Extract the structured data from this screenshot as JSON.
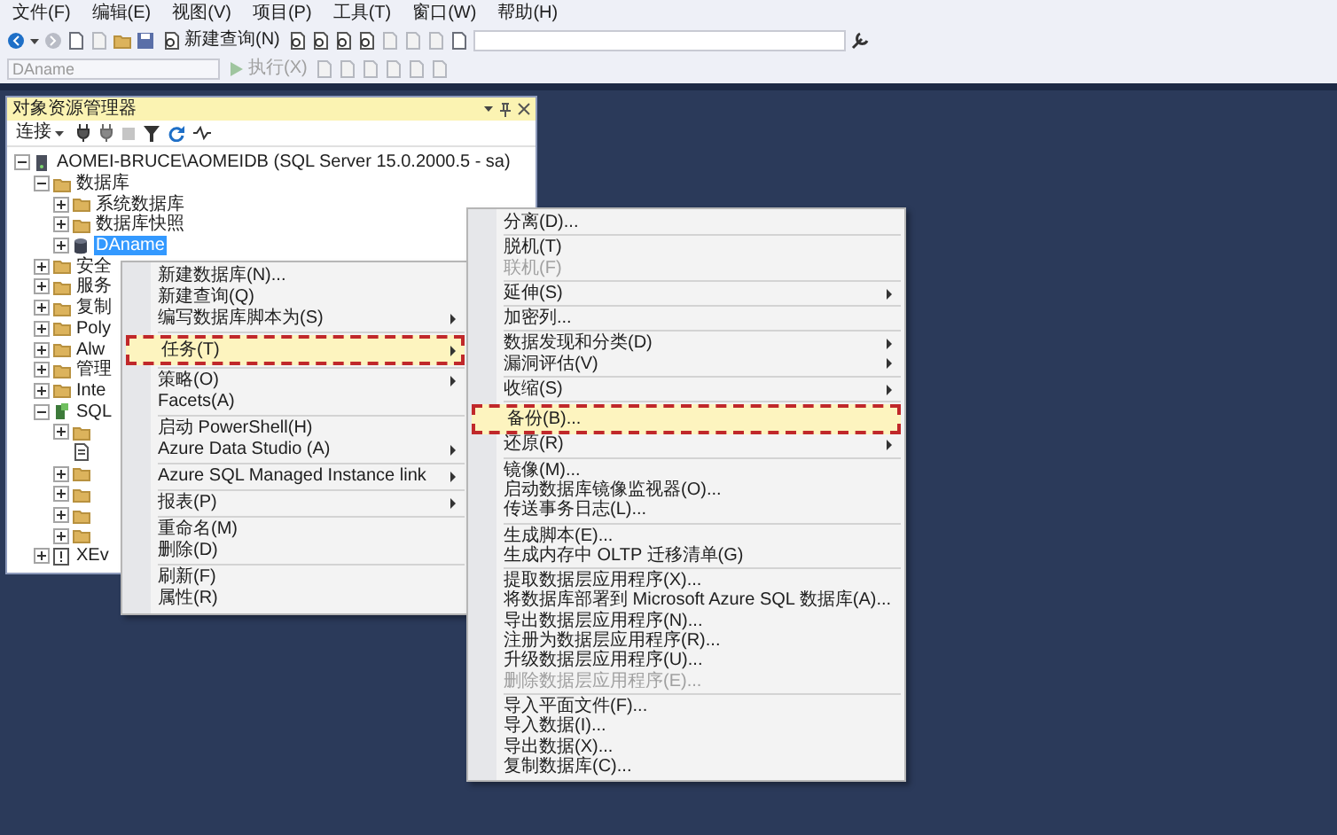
{
  "menubar": [
    "文件(F)",
    "编辑(E)",
    "视图(V)",
    "项目(P)",
    "工具(T)",
    "窗口(W)",
    "帮助(H)"
  ],
  "toolbar": {
    "new_query": "新建查询(N)",
    "database_select": "DAname",
    "execute": "执行(X)"
  },
  "object_explorer": {
    "title": "对象资源管理器",
    "connect": "连接",
    "tree": [
      {
        "label": "AOMEI-BRUCE\\AOMEIDB (SQL Server 15.0.2000.5 - sa)",
        "kind": "server",
        "expanded": true,
        "selected": false,
        "children": [
          {
            "label": "数据库",
            "kind": "folder",
            "expanded": true,
            "selected": false,
            "children": [
              {
                "label": "系统数据库",
                "kind": "folder",
                "expanded": false,
                "selected": false
              },
              {
                "label": "数据库快照",
                "kind": "folder",
                "expanded": false,
                "selected": false
              },
              {
                "label": "DAname",
                "kind": "database",
                "expanded": false,
                "selected": true
              }
            ]
          },
          {
            "label": "安全",
            "kind": "folder",
            "expanded": false,
            "selected": false
          },
          {
            "label": "服务",
            "kind": "folder",
            "expanded": false,
            "selected": false
          },
          {
            "label": "复制",
            "kind": "folder",
            "expanded": false,
            "selected": false
          },
          {
            "label": "Poly",
            "kind": "folder",
            "expanded": false,
            "selected": false
          },
          {
            "label": "Alw",
            "kind": "folder",
            "expanded": false,
            "selected": false
          },
          {
            "label": "管理",
            "kind": "folder",
            "expanded": false,
            "selected": false
          },
          {
            "label": "Inte",
            "kind": "folder",
            "expanded": false,
            "selected": false
          },
          {
            "label": "SQL",
            "kind": "agent",
            "expanded": true,
            "selected": false,
            "children": [
              {
                "kind": "folder",
                "expanded": false,
                "selected": false
              },
              {
                "kind": "job",
                "selected": false
              },
              {
                "kind": "folder",
                "expanded": false,
                "selected": false
              },
              {
                "kind": "folder",
                "expanded": false,
                "selected": false
              },
              {
                "kind": "folder",
                "expanded": false,
                "selected": false
              },
              {
                "kind": "folder",
                "expanded": false,
                "selected": false
              }
            ]
          },
          {
            "label": "XEv",
            "kind": "xevent",
            "expanded": false,
            "selected": false
          }
        ]
      }
    ]
  },
  "context_menu": {
    "items": [
      {
        "kind": "item",
        "label": "新建数据库(N)...",
        "submenu": false,
        "disabled": false,
        "highlighted": false,
        "outlined": false
      },
      {
        "kind": "item",
        "label": "新建查询(Q)",
        "submenu": false,
        "disabled": false,
        "highlighted": false,
        "outlined": false
      },
      {
        "kind": "item",
        "label": "编写数据库脚本为(S)",
        "submenu": true,
        "disabled": false,
        "highlighted": false,
        "outlined": false
      },
      {
        "kind": "separator"
      },
      {
        "kind": "item",
        "label": "任务(T)",
        "submenu": true,
        "disabled": false,
        "highlighted": true,
        "outlined": true
      },
      {
        "kind": "separator"
      },
      {
        "kind": "item",
        "label": "策略(O)",
        "submenu": true,
        "disabled": false,
        "highlighted": false,
        "outlined": false
      },
      {
        "kind": "item",
        "label": "Facets(A)",
        "submenu": false,
        "disabled": false,
        "highlighted": false,
        "outlined": false
      },
      {
        "kind": "separator"
      },
      {
        "kind": "item",
        "label": "启动 PowerShell(H)",
        "submenu": false,
        "disabled": false,
        "highlighted": false,
        "outlined": false
      },
      {
        "kind": "item",
        "label": "Azure Data Studio (A)",
        "submenu": true,
        "disabled": false,
        "highlighted": false,
        "outlined": false
      },
      {
        "kind": "separator"
      },
      {
        "kind": "item",
        "label": "Azure SQL Managed Instance link",
        "submenu": true,
        "disabled": false,
        "highlighted": false,
        "outlined": false
      },
      {
        "kind": "separator"
      },
      {
        "kind": "item",
        "label": "报表(P)",
        "submenu": true,
        "disabled": false,
        "highlighted": false,
        "outlined": false
      },
      {
        "kind": "separator"
      },
      {
        "kind": "item",
        "label": "重命名(M)",
        "submenu": false,
        "disabled": false,
        "highlighted": false,
        "outlined": false
      },
      {
        "kind": "item",
        "label": "删除(D)",
        "submenu": false,
        "disabled": false,
        "highlighted": false,
        "outlined": false
      },
      {
        "kind": "separator"
      },
      {
        "kind": "item",
        "label": "刷新(F)",
        "submenu": false,
        "disabled": false,
        "highlighted": false,
        "outlined": false
      },
      {
        "kind": "item",
        "label": "属性(R)",
        "submenu": false,
        "disabled": false,
        "highlighted": false,
        "outlined": false
      }
    ]
  },
  "tasks_submenu": {
    "items": [
      {
        "kind": "item",
        "label": "分离(D)...",
        "submenu": false,
        "disabled": false,
        "highlighted": false,
        "outlined": false
      },
      {
        "kind": "separator"
      },
      {
        "kind": "item",
        "label": "脱机(T)",
        "submenu": false,
        "disabled": false,
        "highlighted": false,
        "outlined": false
      },
      {
        "kind": "item",
        "label": "联机(F)",
        "submenu": false,
        "disabled": true,
        "highlighted": false,
        "outlined": false
      },
      {
        "kind": "separator"
      },
      {
        "kind": "item",
        "label": "延伸(S)",
        "submenu": true,
        "disabled": false,
        "highlighted": false,
        "outlined": false
      },
      {
        "kind": "separator"
      },
      {
        "kind": "item",
        "label": "加密列...",
        "submenu": false,
        "disabled": false,
        "highlighted": false,
        "outlined": false
      },
      {
        "kind": "separator"
      },
      {
        "kind": "item",
        "label": "数据发现和分类(D)",
        "submenu": true,
        "disabled": false,
        "highlighted": false,
        "outlined": false
      },
      {
        "kind": "item",
        "label": "漏洞评估(V)",
        "submenu": true,
        "disabled": false,
        "highlighted": false,
        "outlined": false
      },
      {
        "kind": "separator"
      },
      {
        "kind": "item",
        "label": "收缩(S)",
        "submenu": true,
        "disabled": false,
        "highlighted": false,
        "outlined": false
      },
      {
        "kind": "separator"
      },
      {
        "kind": "item",
        "label": "备份(B)...",
        "submenu": false,
        "disabled": false,
        "highlighted": true,
        "outlined": true
      },
      {
        "kind": "item",
        "label": "还原(R)",
        "submenu": true,
        "disabled": false,
        "highlighted": false,
        "outlined": false
      },
      {
        "kind": "separator"
      },
      {
        "kind": "item",
        "label": "镜像(M)...",
        "submenu": false,
        "disabled": false,
        "highlighted": false,
        "outlined": false
      },
      {
        "kind": "item",
        "label": "启动数据库镜像监视器(O)...",
        "submenu": false,
        "disabled": false,
        "highlighted": false,
        "outlined": false
      },
      {
        "kind": "item",
        "label": "传送事务日志(L)...",
        "submenu": false,
        "disabled": false,
        "highlighted": false,
        "outlined": false
      },
      {
        "kind": "separator"
      },
      {
        "kind": "item",
        "label": "生成脚本(E)...",
        "submenu": false,
        "disabled": false,
        "highlighted": false,
        "outlined": false
      },
      {
        "kind": "item",
        "label": "生成内存中 OLTP 迁移清单(G)",
        "submenu": false,
        "disabled": false,
        "highlighted": false,
        "outlined": false
      },
      {
        "kind": "separator"
      },
      {
        "kind": "item",
        "label": "提取数据层应用程序(X)...",
        "submenu": false,
        "disabled": false,
        "highlighted": false,
        "outlined": false
      },
      {
        "kind": "item",
        "label": "将数据库部署到 Microsoft Azure SQL 数据库(A)...",
        "submenu": false,
        "disabled": false,
        "highlighted": false,
        "outlined": false
      },
      {
        "kind": "item",
        "label": "导出数据层应用程序(N)...",
        "submenu": false,
        "disabled": false,
        "highlighted": false,
        "outlined": false
      },
      {
        "kind": "item",
        "label": "注册为数据层应用程序(R)...",
        "submenu": false,
        "disabled": false,
        "highlighted": false,
        "outlined": false
      },
      {
        "kind": "item",
        "label": "升级数据层应用程序(U)...",
        "submenu": false,
        "disabled": false,
        "highlighted": false,
        "outlined": false
      },
      {
        "kind": "item",
        "label": "删除数据层应用程序(E)...",
        "submenu": false,
        "disabled": true,
        "highlighted": false,
        "outlined": false
      },
      {
        "kind": "separator"
      },
      {
        "kind": "item",
        "label": "导入平面文件(F)...",
        "submenu": false,
        "disabled": false,
        "highlighted": false,
        "outlined": false
      },
      {
        "kind": "item",
        "label": "导入数据(I)...",
        "submenu": false,
        "disabled": false,
        "highlighted": false,
        "outlined": false
      },
      {
        "kind": "item",
        "label": "导出数据(X)...",
        "submenu": false,
        "disabled": false,
        "highlighted": false,
        "outlined": false
      },
      {
        "kind": "item",
        "label": "复制数据库(C)...",
        "submenu": false,
        "disabled": false,
        "highlighted": false,
        "outlined": false
      }
    ]
  }
}
